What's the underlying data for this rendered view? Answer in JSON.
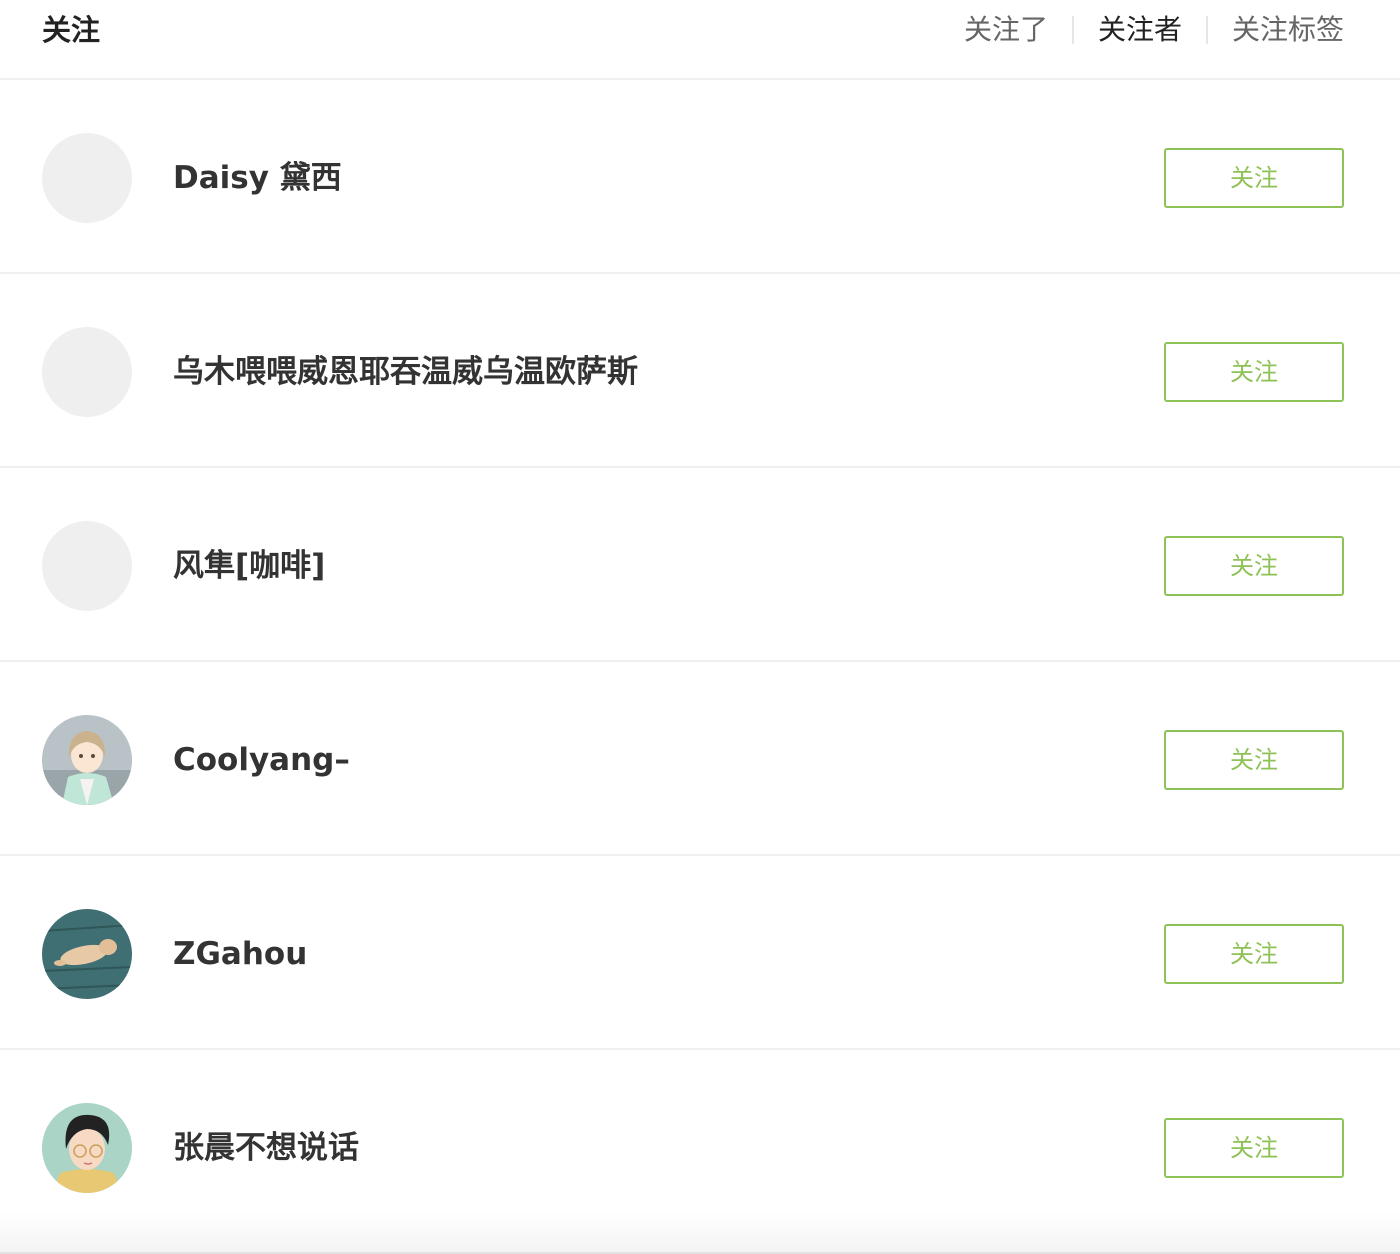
{
  "header": {
    "title": "关注",
    "tabs": [
      {
        "label": "关注了",
        "active": false
      },
      {
        "label": "关注者",
        "active": true
      },
      {
        "label": "关注标签",
        "active": false
      }
    ]
  },
  "colors": {
    "accent": "#8fc256",
    "divider": "#f0f0f0",
    "avatar_placeholder": "#efefef"
  },
  "users": [
    {
      "name": "Daisy 黛西",
      "avatar": "placeholder",
      "button": "关注"
    },
    {
      "name": "乌木喂喂威恩耶吞温威乌温欧萨斯",
      "avatar": "placeholder",
      "button": "关注"
    },
    {
      "name": "风隼[咖啡]",
      "avatar": "placeholder",
      "button": "关注"
    },
    {
      "name": "Coolyang–",
      "avatar": "anime-boy-illustration",
      "button": "关注"
    },
    {
      "name": "ZGahou",
      "avatar": "dog-on-wooden-deck",
      "button": "关注"
    },
    {
      "name": "张晨不想说话",
      "avatar": "illustrated-boy-with-glasses",
      "button": "关注"
    }
  ]
}
